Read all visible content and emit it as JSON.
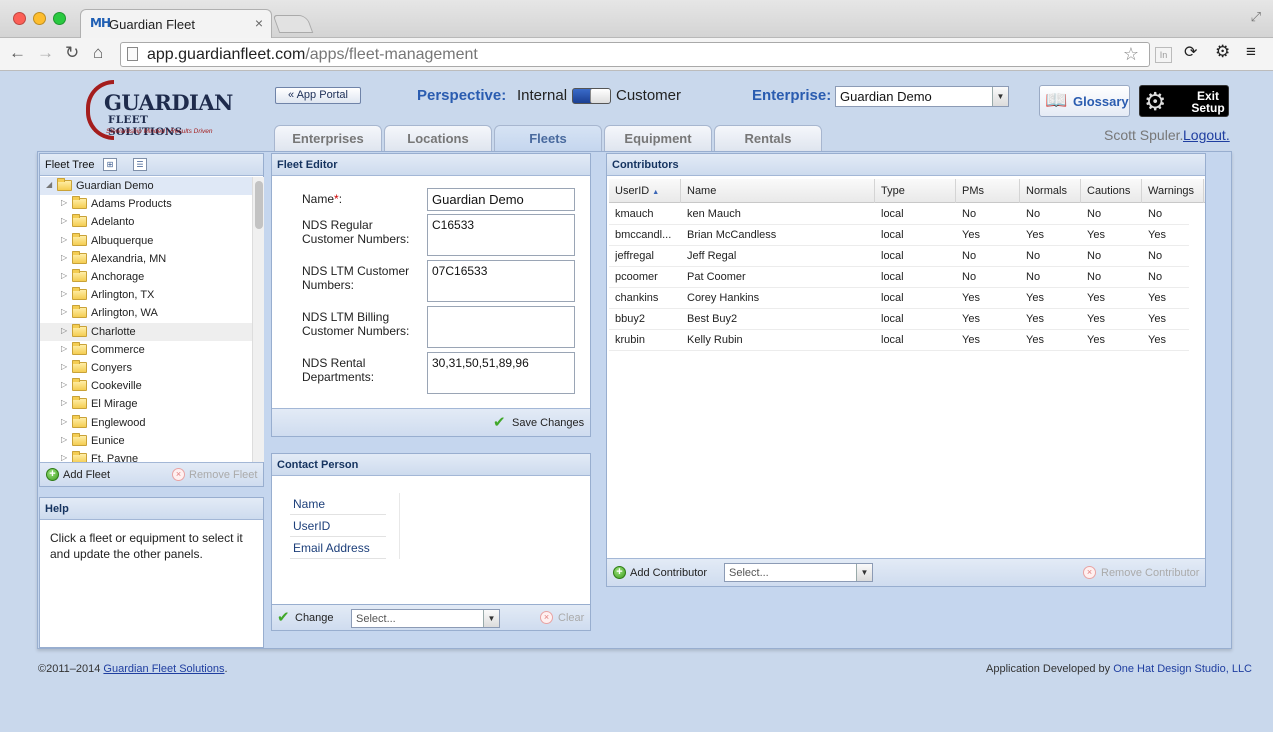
{
  "browser": {
    "tab_favicon": "MH",
    "tab_title": "Guardian Fleet",
    "url_host": "app.guardianfleet.com",
    "url_path": "/apps/fleet-management",
    "icons": [
      "back-arrow-icon",
      "forward-arrow-icon",
      "reload-icon",
      "home-icon",
      "star-icon",
      "sync-icon",
      "gear-icon",
      "menu-icon"
    ],
    "ext_in_label": "In"
  },
  "header": {
    "logo_title": "GUARDIAN",
    "logo_subtitle": "FLEET SOLUTIONS",
    "logo_tagline": "Stewardship Minded | Results Driven",
    "app_portal_label": "« App Portal",
    "perspective_label": "Perspective:",
    "perspective_internal": "Internal",
    "perspective_customer": "Customer",
    "enterprise_label": "Enterprise:",
    "enterprise_value": "Guardian Demo",
    "glossary_label": "Glossary",
    "exit_label": "Exit Setup",
    "tabs": [
      {
        "label": "Enterprises"
      },
      {
        "label": "Locations"
      },
      {
        "label": "Fleets"
      },
      {
        "label": "Equipment"
      },
      {
        "label": "Rentals"
      }
    ],
    "active_tab": "Fleets",
    "user_name": "Scott Spuler.",
    "logout_label": "Logout."
  },
  "fleet_tree": {
    "title": "Fleet Tree",
    "root": "Guardian Demo",
    "items": [
      "Adams Products",
      "Adelanto",
      "Albuquerque",
      "Alexandria, MN",
      "Anchorage",
      "Arlington, TX",
      "Arlington, WA",
      "Charlotte",
      "Commerce",
      "Conyers",
      "Cookeville",
      "El Mirage",
      "Englewood",
      "Eunice",
      "Ft. Payne"
    ],
    "add_label": "Add Fleet",
    "remove_label": "Remove Fleet"
  },
  "help": {
    "title": "Help",
    "text": "Click a fleet or equipment to select it and update the other panels."
  },
  "fleet_editor": {
    "title": "Fleet Editor",
    "name_label": "Name",
    "name_required": "*",
    "name_colon": ":",
    "name_value": "Guardian Demo",
    "regular_label": "NDS Regular Customer Numbers:",
    "regular_value": "C16533",
    "ltm_label": "NDS LTM Customer Numbers:",
    "ltm_value": "07C16533",
    "billing_label": "NDS LTM Billing Customer Numbers:",
    "billing_value": "",
    "rental_label": "NDS Rental Departments:",
    "rental_value": "30,31,50,51,89,96",
    "save_label": "Save Changes"
  },
  "contact": {
    "title": "Contact Person",
    "rows": [
      "Name",
      "UserID",
      "Email Address"
    ],
    "change_label": "Change",
    "select_placeholder": "Select...",
    "clear_label": "Clear"
  },
  "contributors": {
    "title": "Contributors",
    "columns": [
      "UserID",
      "Name",
      "Type",
      "PMs",
      "Normals",
      "Cautions",
      "Warnings"
    ],
    "rows": [
      [
        "kmauch",
        "ken Mauch",
        "local",
        "No",
        "No",
        "No",
        "No"
      ],
      [
        "bmccandl...",
        "Brian McCandless",
        "local",
        "Yes",
        "Yes",
        "Yes",
        "Yes"
      ],
      [
        "jeffregal",
        "Jeff Regal",
        "local",
        "No",
        "No",
        "No",
        "No"
      ],
      [
        "pcoomer",
        "Pat Coomer",
        "local",
        "No",
        "No",
        "No",
        "No"
      ],
      [
        "chankins",
        "Corey Hankins",
        "local",
        "Yes",
        "Yes",
        "Yes",
        "Yes"
      ],
      [
        "bbuy2",
        "Best Buy2",
        "local",
        "Yes",
        "Yes",
        "Yes",
        "Yes"
      ],
      [
        "krubin",
        "Kelly Rubin",
        "local",
        "Yes",
        "Yes",
        "Yes",
        "Yes"
      ]
    ],
    "add_label": "Add Contributor",
    "select_placeholder": "Select...",
    "remove_label": "Remove Contributor"
  },
  "footer": {
    "copyright_prefix": "©2011–2014 ",
    "copyright_link": "Guardian Fleet Solutions",
    "copyright_suffix": ".",
    "dev_prefix": "Application Developed by ",
    "dev_link": "One Hat Design Studio, LLC"
  },
  "colors": {
    "accent": "#2a5cb0",
    "panel_bg": "#c5d6ee",
    "brand_red": "#a41d1d",
    "success_green": "#41a82a"
  }
}
